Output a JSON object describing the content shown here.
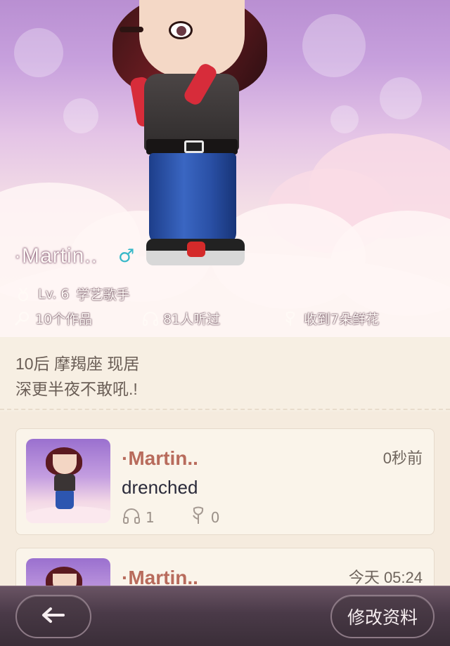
{
  "profile": {
    "name": "·Martin..",
    "gender_symbol": "♂",
    "level": "Lv. 6",
    "title": "学艺歌手",
    "works": "10个作品",
    "listeners": "81人听过",
    "flowers": "收到7朵鲜花",
    "bio_line1": "10后 摩羯座 现居",
    "bio_line2": "深更半夜不敢吼.!"
  },
  "feed": [
    {
      "author": "·Martin..",
      "time": "0秒前",
      "title": "drenched",
      "listens": "1",
      "flowers": "0"
    },
    {
      "author": "·Martin..",
      "time": "今天 05:24"
    }
  ],
  "bottombar": {
    "back_icon": "arrow-left-icon",
    "edit_label": "修改资料"
  }
}
